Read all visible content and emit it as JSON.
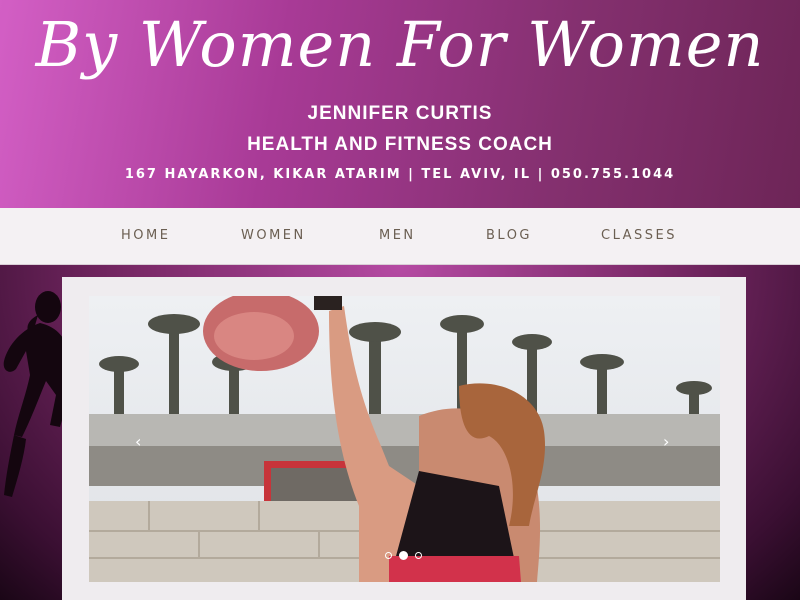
{
  "header": {
    "site_title": "By Women For Women",
    "coach_name": "JENNIFER CURTIS",
    "coach_role": "HEALTH AND FITNESS COACH",
    "address": "167 HAYARKON, KIKAR ATARIM | TEL AVIV, IL | 050.755.1044"
  },
  "nav": {
    "items": [
      {
        "label": "HOME"
      },
      {
        "label": "WOMEN"
      },
      {
        "label": "MEN"
      },
      {
        "label": "BLOG"
      },
      {
        "label": "CLASSES"
      }
    ]
  },
  "slider": {
    "prev_icon": "chevron-left-icon",
    "next_icon": "chevron-right-icon",
    "prev_glyph": "‹",
    "next_glyph": "›",
    "slide_count": 3,
    "active_slide": 2,
    "image": "woman-lifting-kettlebell-photo"
  },
  "colors": {
    "header_start": "#d35fc5",
    "header_end": "#6d2557",
    "nav_bg": "#f4f1f3",
    "nav_text": "#6b5f52"
  }
}
